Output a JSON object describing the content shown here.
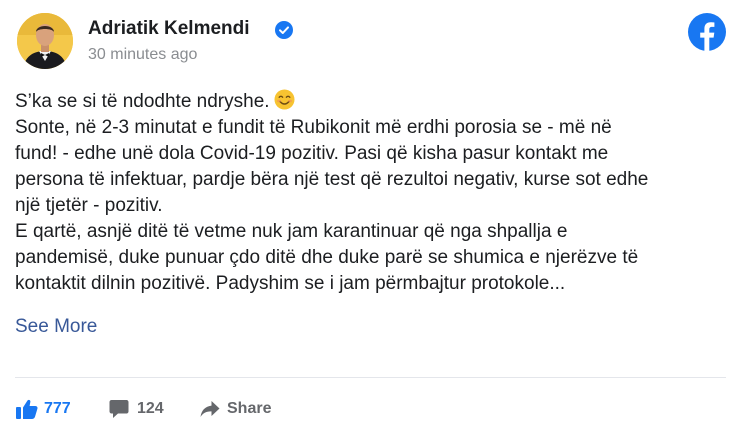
{
  "author": {
    "name": "Adriatik Kelmendi",
    "verified": true,
    "avatar_icon": "avatar-photo-icon"
  },
  "timestamp": "30 minutes ago",
  "brand": {
    "logo": "facebook-logo-icon",
    "color": "#1877f2"
  },
  "post": {
    "lines": [
      "S’ka se si të ndodhte ndryshe.",
      "Sonte, në 2-3 minutat e fundit të Rubikonit më erdhi porosia se - më në",
      "fund! - edhe unë dola Covid-19 pozitiv. Pasi që kisha pasur kontakt me",
      "persona të infektuar, pardje bëra një test që rezultoi negativ, kurse sot edhe",
      "një tjetër - pozitiv.",
      "E qartë, asnjë ditë të vetme nuk jam karantinuar që nga shpallja e",
      "pandemisë, duke punuar çdo ditë dhe duke parë se shumica e njerëzve të",
      "kontaktit dilnin pozitivë. Padyshim se i jam përmbajtur protokole..."
    ],
    "emoji": "smiling-face-emoji",
    "see_more": "See More"
  },
  "footer": {
    "likes": "777",
    "comments": "124",
    "share_label": "Share"
  }
}
